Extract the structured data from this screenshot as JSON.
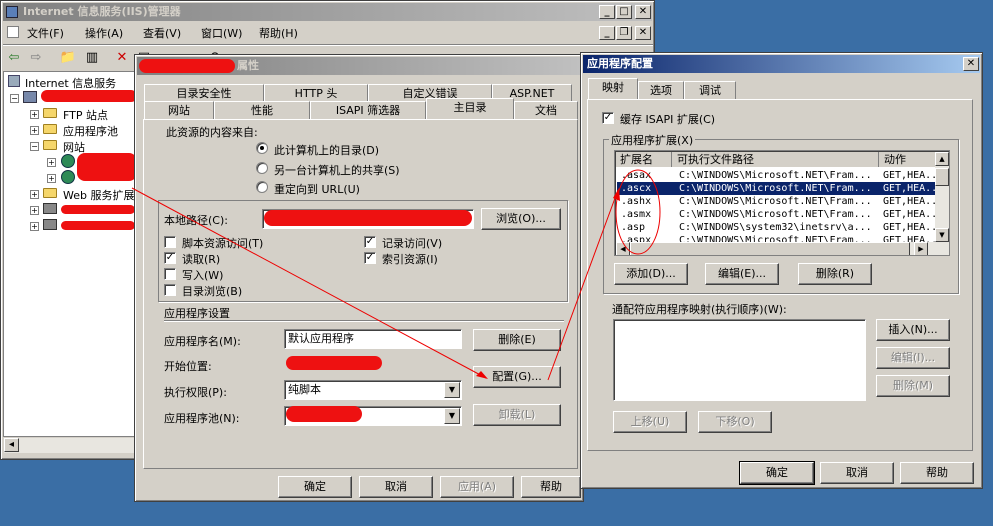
{
  "iis": {
    "title": "Internet 信息服务(IIS)管理器",
    "menu": [
      "文件(F)",
      "操作(A)",
      "查看(V)",
      "窗口(W)",
      "帮助(H)"
    ],
    "tree": {
      "root": "Internet 信息服务",
      "ftp": "FTP 站点",
      "apppool": "应用程序池",
      "sites": "网站",
      "webext": "Web 服务扩展"
    }
  },
  "props": {
    "title_suffix": "属性",
    "tabs_row1": [
      "目录安全性",
      "HTTP 头",
      "自定义错误",
      "ASP.NET"
    ],
    "tabs_row2": [
      "网站",
      "性能",
      "ISAPI 筛选器",
      "主目录",
      "文档"
    ],
    "content_source_label": "此资源的内容来自:",
    "radio_local": "此计算机上的目录(D)",
    "radio_share": "另一台计算机上的共享(S)",
    "radio_url": "重定向到 URL(U)",
    "local_path_label": "本地路径(C):",
    "browse_button": "浏览(O)...",
    "cb_script_source": "脚本资源访问(T)",
    "cb_read": "读取(R)",
    "cb_write": "写入(W)",
    "cb_dir_browse": "目录浏览(B)",
    "cb_log_visits": "记录访问(V)",
    "cb_index": "索引资源(I)",
    "app_settings_label": "应用程序设置",
    "app_name_label": "应用程序名(M):",
    "app_name_value": "默认应用程序",
    "remove_button": "删除(E)",
    "start_point_label": "开始位置:",
    "exec_perm_label": "执行权限(P):",
    "exec_perm_value": "纯脚本",
    "config_button": "配置(G)...",
    "app_pool_label": "应用程序池(N):",
    "unload_button": "卸载(L)",
    "ok": "确定",
    "cancel": "取消",
    "apply": "应用(A)",
    "help": "帮助"
  },
  "appconfig": {
    "title": "应用程序配置",
    "close": "✕",
    "tabs": [
      "映射",
      "选项",
      "调试"
    ],
    "cache_isapi": "缓存 ISAPI 扩展(C)",
    "ext_group_label": "应用程序扩展(X)",
    "columns": [
      "扩展名",
      "可执行文件路径",
      "动作"
    ],
    "rows": [
      {
        "ext": ".asax",
        "path": "C:\\WINDOWS\\Microsoft.NET\\Fram...",
        "verb": "GET,HEA..."
      },
      {
        "ext": ".ascx",
        "path": "C:\\WINDOWS\\Microsoft.NET\\Fram...",
        "verb": "GET,HEA..."
      },
      {
        "ext": ".ashx",
        "path": "C:\\WINDOWS\\Microsoft.NET\\Fram...",
        "verb": "GET,HEA..."
      },
      {
        "ext": ".asmx",
        "path": "C:\\WINDOWS\\Microsoft.NET\\Fram...",
        "verb": "GET,HEA..."
      },
      {
        "ext": ".asp",
        "path": "C:\\WINDOWS\\system32\\inetsrv\\a...",
        "verb": "GET,HEA..."
      },
      {
        "ext": ".aspx",
        "path": "C:\\WINDOWS\\Microsoft.NET\\Fram...",
        "verb": "GET,HEA..."
      }
    ],
    "add_button": "添加(D)...",
    "edit_button": "编辑(E)...",
    "remove_button": "删除(R)",
    "wildcard_label": "通配符应用程序映射(执行顺序)(W):",
    "insert_button": "插入(N)...",
    "wc_edit_button": "编辑(I)...",
    "wc_remove_button": "删除(M)",
    "move_up": "上移(U)",
    "move_down": "下移(O)",
    "ok": "确定",
    "cancel": "取消",
    "help": "帮助"
  }
}
